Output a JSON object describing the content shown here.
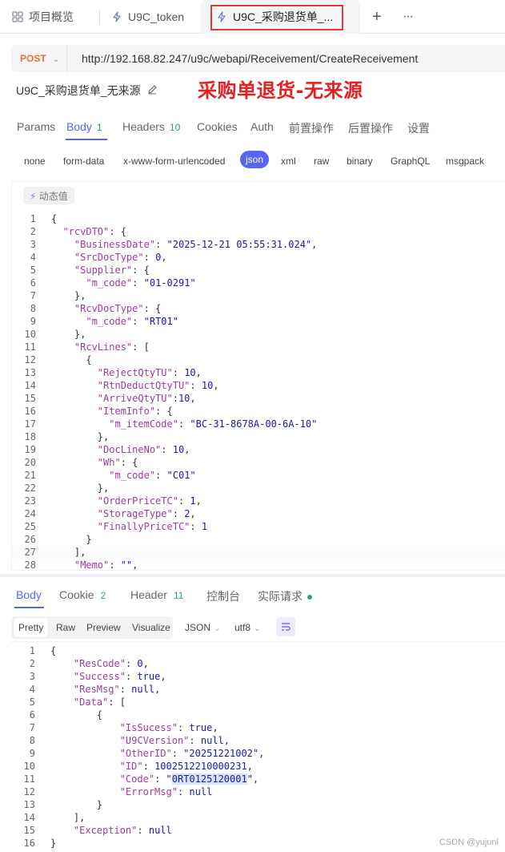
{
  "tabs": [
    {
      "label": "项目概览",
      "icon": "grid-icon"
    },
    {
      "label": "U9C_token",
      "icon": "bolt-icon"
    },
    {
      "label": "U9C_采购退货单_...",
      "icon": "bolt-icon"
    }
  ],
  "tabbar": {
    "add_label": "+",
    "more_label": "···"
  },
  "request": {
    "method": "POST",
    "url": "http://192.168.82.247/u9c/webapi/Receivement/CreateReceivement",
    "name": "U9C_采购退货单_无来源",
    "annotation": "采购单退货-无来源"
  },
  "request_tabs": [
    {
      "label": "Params"
    },
    {
      "label": "Body",
      "count": "1"
    },
    {
      "label": "Headers",
      "count": "10"
    },
    {
      "label": "Cookies"
    },
    {
      "label": "Auth"
    },
    {
      "label": "前置操作"
    },
    {
      "label": "后置操作"
    },
    {
      "label": "设置"
    }
  ],
  "body_types": [
    "none",
    "form-data",
    "x-www-form-urlencoded",
    "json",
    "xml",
    "raw",
    "binary",
    "GraphQL",
    "msgpack"
  ],
  "dynamic_value_label": "动态值",
  "request_body": [
    {
      "n": "1",
      "t": "{"
    },
    {
      "n": "2",
      "t": "  \"rcvDTO\": {"
    },
    {
      "n": "3",
      "t": "    \"BusinessDate\": \"2025-12-21 05:55:31.024\","
    },
    {
      "n": "4",
      "t": "    \"SrcDocType\": 0,"
    },
    {
      "n": "5",
      "t": "    \"Supplier\": {"
    },
    {
      "n": "6",
      "t": "      \"m_code\": \"01-0291\""
    },
    {
      "n": "7",
      "t": "    },"
    },
    {
      "n": "8",
      "t": "    \"RcvDocType\": {"
    },
    {
      "n": "9",
      "t": "      \"m_code\": \"RT01\""
    },
    {
      "n": "10",
      "t": "    },"
    },
    {
      "n": "11",
      "t": "    \"RcvLines\": ["
    },
    {
      "n": "12",
      "t": "      {"
    },
    {
      "n": "13",
      "t": "        \"RejectQtyTU\": 10,"
    },
    {
      "n": "14",
      "t": "        \"RtnDeductQtyTU\": 10,"
    },
    {
      "n": "15",
      "t": "        \"ArriveQtyTU\":10,"
    },
    {
      "n": "16",
      "t": "        \"ItemInfo\": {"
    },
    {
      "n": "17",
      "t": "          \"m_itemCode\": \"BC-31-8678A-00-6A-10\""
    },
    {
      "n": "18",
      "t": "        },"
    },
    {
      "n": "19",
      "t": "        \"DocLineNo\": 10,"
    },
    {
      "n": "20",
      "t": "        \"Wh\": {"
    },
    {
      "n": "21",
      "t": "          \"m_code\": \"C01\""
    },
    {
      "n": "22",
      "t": "        },"
    },
    {
      "n": "23",
      "t": "        \"OrderPriceTC\": 1,"
    },
    {
      "n": "24",
      "t": "        \"StorageType\": 2,"
    },
    {
      "n": "25",
      "t": "        \"FinallyPriceTC\": 1"
    },
    {
      "n": "26",
      "t": "      }"
    },
    {
      "n": "27",
      "t": "    ],"
    },
    {
      "n": "28",
      "t": "    \"Memo\": \"\","
    }
  ],
  "response_tabs": [
    {
      "label": "Body"
    },
    {
      "label": "Cookie",
      "count": "2"
    },
    {
      "label": "Header",
      "count": "11"
    },
    {
      "label": "控制台"
    },
    {
      "label": "实际请求"
    }
  ],
  "view_modes": [
    "Pretty",
    "Raw",
    "Preview",
    "Visualize"
  ],
  "format_select": "JSON",
  "encoding_select": "utf8",
  "response_body": [
    {
      "n": "1",
      "t": "{"
    },
    {
      "n": "2",
      "t": "    \"ResCode\": 0,"
    },
    {
      "n": "3",
      "t": "    \"Success\": true,"
    },
    {
      "n": "4",
      "t": "    \"ResMsg\": null,"
    },
    {
      "n": "5",
      "t": "    \"Data\": ["
    },
    {
      "n": "6",
      "t": "        {"
    },
    {
      "n": "7",
      "t": "            \"IsSucess\": true,"
    },
    {
      "n": "8",
      "t": "            \"U9CVersion\": null,"
    },
    {
      "n": "9",
      "t": "            \"OtherID\": \"20251221002\","
    },
    {
      "n": "10",
      "t": "            \"ID\": 1002512210000231,"
    },
    {
      "n": "11",
      "t": "            \"Code\": \"0RT0125120001\","
    },
    {
      "n": "12",
      "t": "            \"ErrorMsg\": null"
    },
    {
      "n": "13",
      "t": "        }"
    },
    {
      "n": "14",
      "t": "    ],"
    },
    {
      "n": "15",
      "t": "    \"Exception\": null"
    },
    {
      "n": "16",
      "t": "}"
    }
  ],
  "watermark": "CSDN @yujunl",
  "colors": {
    "accent": "#5865f2",
    "method": "#e8742c",
    "annotation": "#e52020",
    "count": "#2aa66a"
  }
}
